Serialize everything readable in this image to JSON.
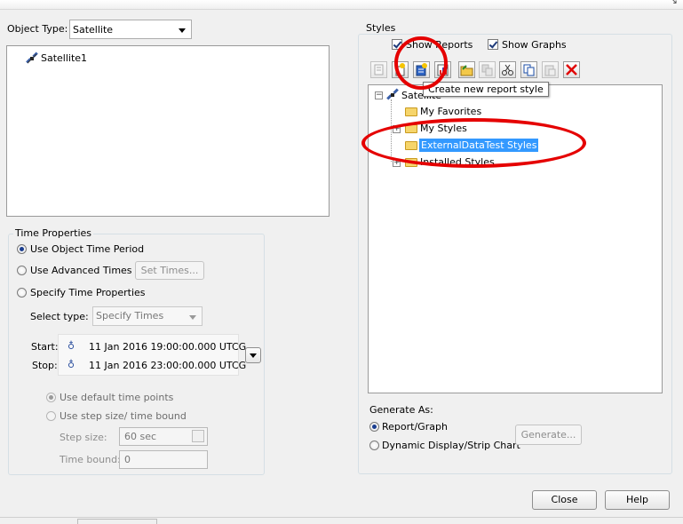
{
  "object_type": {
    "label": "Object Type:",
    "value": "Satellite"
  },
  "objects": [
    {
      "name": "Satellite1",
      "icon": "satellite-icon"
    }
  ],
  "time_properties": {
    "legend": "Time Properties",
    "use_object_time_period": "Use Object Time Period",
    "use_advanced_times": "Use Advanced Times",
    "set_times_button": "Set Times...",
    "specify_time_properties": "Specify Time Properties",
    "select_type_label": "Select type:",
    "select_type_value": "Specify Times",
    "start_label": "Start:",
    "start_value": "11 Jan 2016 19:00:00.000 UTCG",
    "stop_label": "Stop:",
    "stop_value": "11 Jan 2016 23:00:00.000 UTCG",
    "use_default_time_points": "Use default time points",
    "use_step_size": "Use step size/ time bound",
    "step_size_label": "Step size:",
    "step_size_value": "60 sec",
    "time_bound_label": "Time bound:",
    "time_bound_value": "0",
    "selected_option": "use_object_time_period"
  },
  "styles": {
    "legend": "Styles",
    "show_reports": "Show Reports",
    "show_graphs": "Show Graphs",
    "show_reports_checked": true,
    "show_graphs_checked": true,
    "toolbar_icons": [
      "properties-icon",
      "new-style-icon",
      "new-report-style-icon",
      "new-graph-style-icon",
      "open-folder-icon",
      "duplicate-icon",
      "cut-icon",
      "copy-icon",
      "paste-icon",
      "delete-icon"
    ],
    "tooltip": "Create new report style",
    "tree": {
      "root": "Satellite",
      "children": [
        "My Favorites",
        "My Styles",
        "ExternalDataTest Styles",
        "Installed Styles"
      ],
      "selected": "ExternalDataTest Styles"
    }
  },
  "generate": {
    "label": "Generate As:",
    "report_graph": "Report/Graph",
    "dynamic_display": "Dynamic Display/Strip Chart",
    "selected": "report_graph",
    "generate_button": "Generate..."
  },
  "footer": {
    "close_button": "Close",
    "help_button": "Help"
  },
  "colors": {
    "highlight": "#3399ff",
    "annotation_red": "#e50000",
    "delete_red": "#e00000"
  }
}
